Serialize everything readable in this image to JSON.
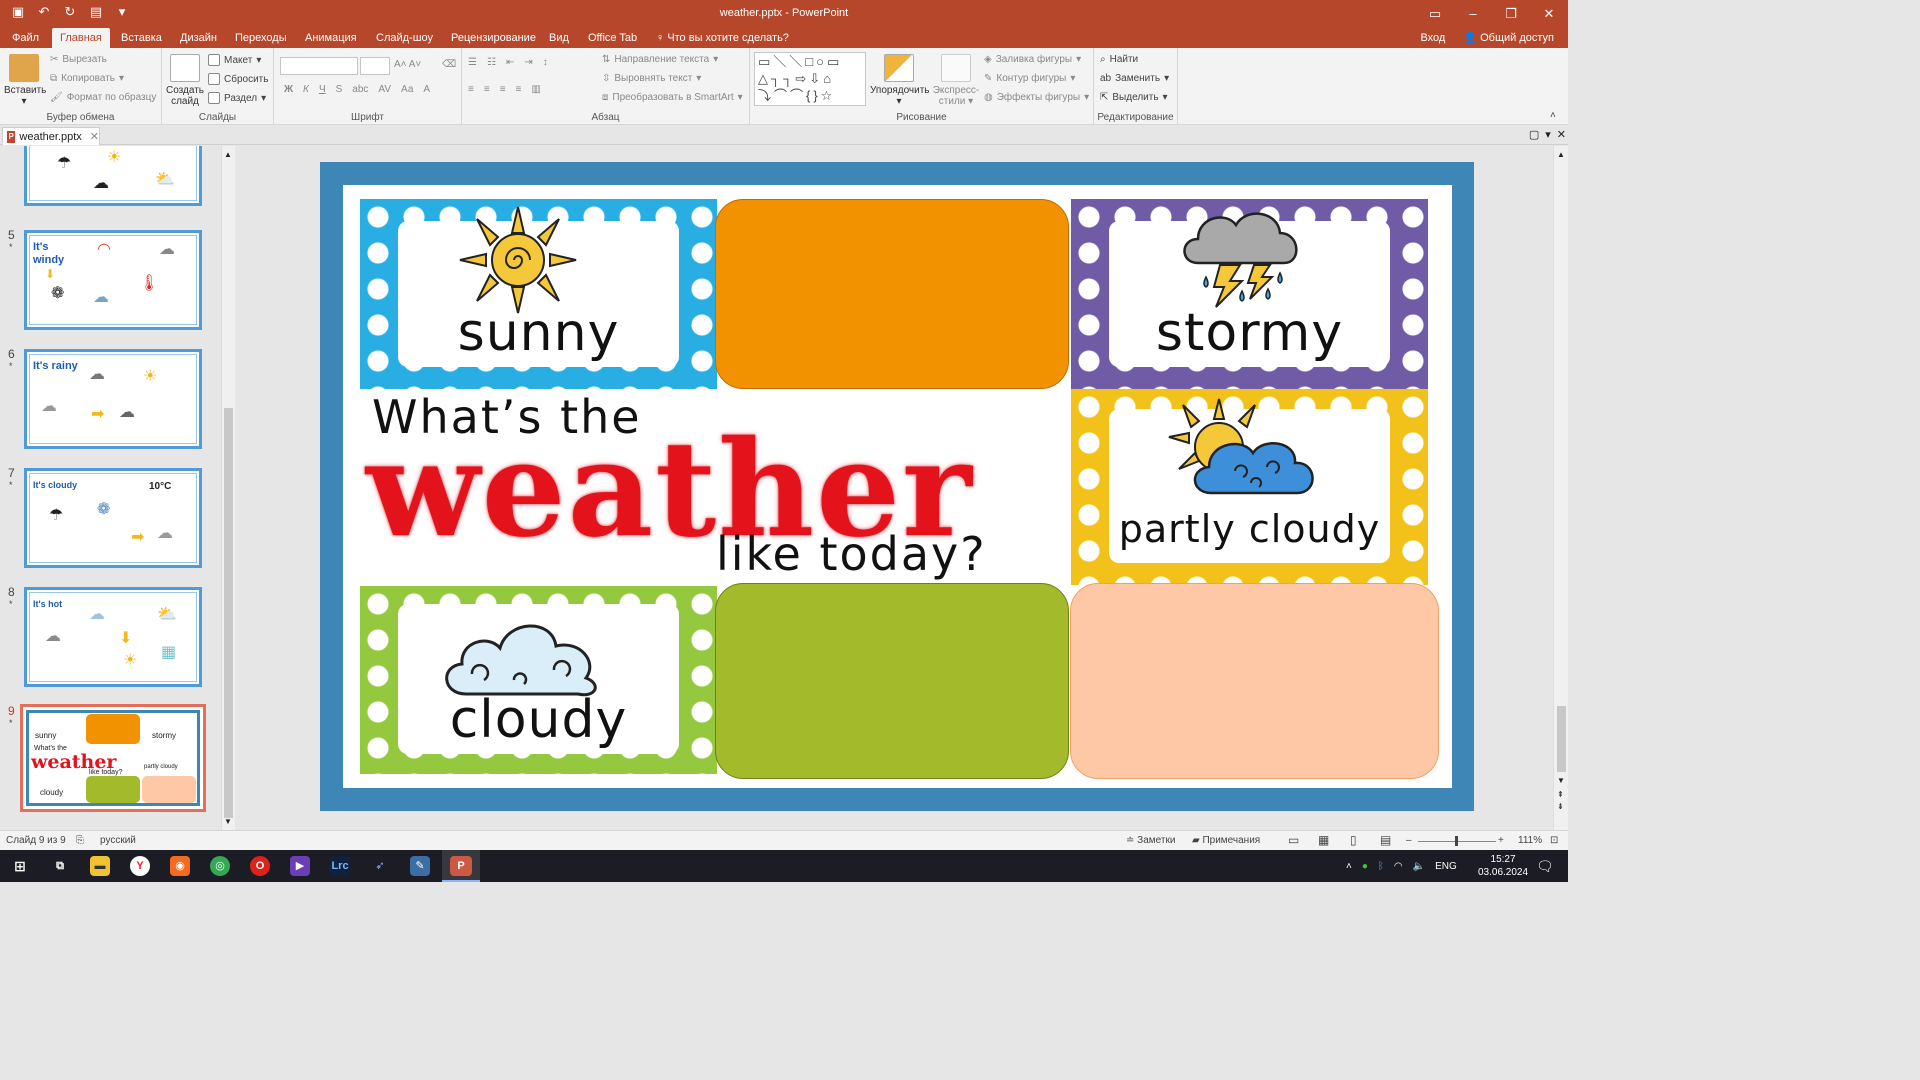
{
  "window": {
    "title": "weather.pptx - PowerPoint"
  },
  "tabs": [
    "Файл",
    "Главная",
    "Вставка",
    "Дизайн",
    "Переходы",
    "Анимация",
    "Слайд-шоу",
    "Рецензирование",
    "Вид",
    "Office Tab"
  ],
  "tell_me": "Что вы хотите сделать?",
  "signin": "Вход",
  "share": "Общий доступ",
  "ribbon": {
    "clipboard": {
      "paste": "Вставить",
      "cut": "Вырезать",
      "copy": "Копировать",
      "format_painter": "Формат по образцу",
      "label": "Буфер обмена"
    },
    "slides": {
      "new_slide": "Создать слайд",
      "layout": "Макет",
      "reset": "Сбросить",
      "section": "Раздел",
      "label": "Слайды"
    },
    "font": {
      "bold": "Ж",
      "italic": "К",
      "underline": "Ч",
      "shadow": "S",
      "spacing": "AV",
      "case": "Аа",
      "color": "A",
      "label": "Шрифт"
    },
    "paragraph": {
      "text_direction": "Направление текста",
      "align_text": "Выровнять текст",
      "smartart": "Преобразовать в SmartArt",
      "label": "Абзац"
    },
    "drawing": {
      "arrange": "Упорядочить",
      "quick_styles": "Экспресс-стили",
      "fill": "Заливка фигуры",
      "outline": "Контур фигуры",
      "effects": "Эффекты фигуры",
      "label": "Рисование"
    },
    "editing": {
      "find": "Найти",
      "replace": "Заменить",
      "select": "Выделить",
      "label": "Редактирование"
    }
  },
  "doc_tab": "weather.pptx",
  "thumbnails": [
    {
      "num": "5",
      "caption": "It's windy"
    },
    {
      "num": "6",
      "caption": "It's rainy"
    },
    {
      "num": "7",
      "caption": "It's cloudy",
      "badge": "10°C"
    },
    {
      "num": "8",
      "caption": "It's hot"
    },
    {
      "num": "9",
      "caption": ""
    }
  ],
  "slide": {
    "cards": {
      "sunny": "sunny",
      "stormy": "stormy",
      "partly_cloudy": "partly cloudy",
      "cloudy": "cloudy"
    },
    "heading": {
      "line1": "What’s the",
      "line2": "weather",
      "line3": "like today?"
    },
    "mini_words": {
      "sunny": "sunny",
      "stormy": "stormy",
      "whats": "What’s the",
      "weather": "weather",
      "like": "like today?",
      "partly": "partly cloudy",
      "cloudy": "cloudy"
    }
  },
  "status": {
    "slide": "Слайд 9 из 9",
    "language": "русский",
    "notes": "Заметки",
    "comments": "Примечания",
    "zoom": "111%"
  },
  "taskbar": {
    "time": "15:27",
    "date": "03.06.2024",
    "lang": "ENG"
  },
  "colors": {
    "accent": "#b7472a",
    "orange": "#f39200",
    "green": "#a3ba2b",
    "peach": "#fec8a6",
    "frame": "#3e86b5"
  }
}
